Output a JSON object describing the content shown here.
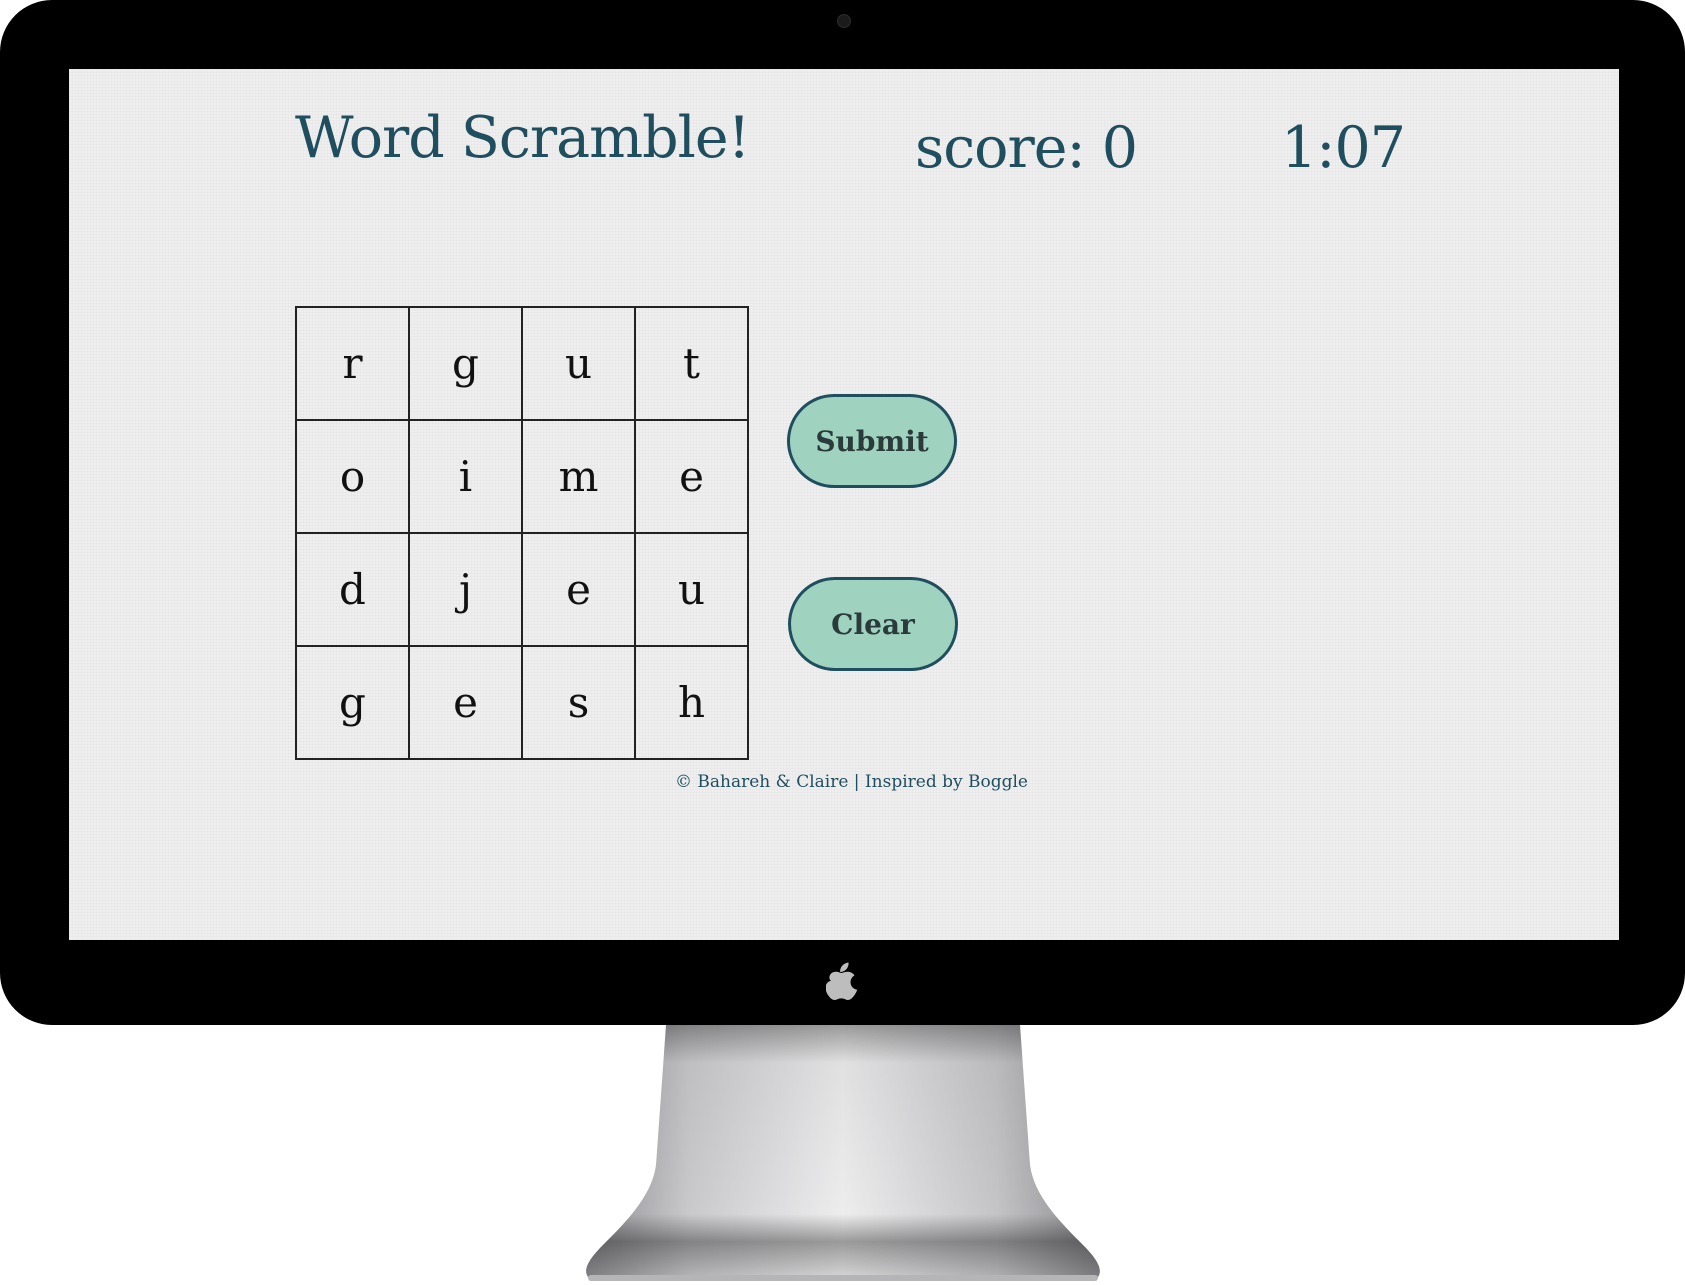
{
  "header": {
    "title": "Word Scramble!",
    "score": "score: 0",
    "timer": "1:07"
  },
  "board": {
    "rows": [
      [
        "r",
        "g",
        "u",
        "t"
      ],
      [
        "o",
        "i",
        "m",
        "e"
      ],
      [
        "d",
        "j",
        "e",
        "u"
      ],
      [
        "g",
        "e",
        "s",
        "h"
      ]
    ]
  },
  "buttons": {
    "submit_label": "Submit",
    "clear_label": "Clear"
  },
  "footer": {
    "text": "© Bahareh & Claire | Inspired by Boggle"
  },
  "icons": {
    "device_logo": "apple-logo-icon",
    "camera": "camera-icon"
  },
  "colors": {
    "text_primary": "#1f4e5f",
    "button_fill": "#9fd3bf",
    "button_border": "#1f4e5f",
    "screen_background": "#efefef"
  }
}
